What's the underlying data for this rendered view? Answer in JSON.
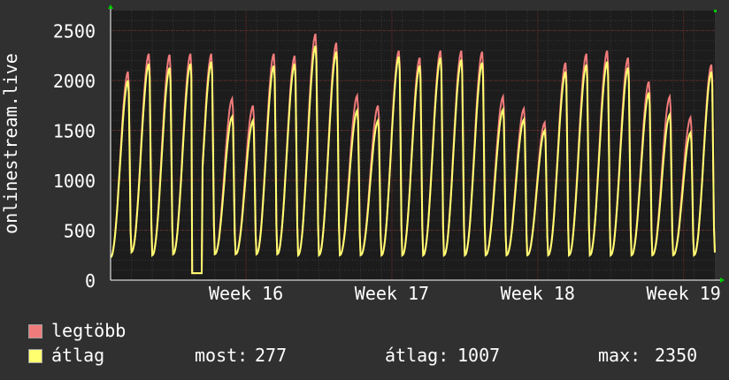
{
  "chart_data": {
    "type": "line",
    "ylabel": "onlinestream.live",
    "ylim": [
      0,
      2700
    ],
    "yticks": [
      0,
      500,
      1000,
      1500,
      2000,
      2500
    ],
    "x_tick_labels": [
      "Week 16",
      "Week 17",
      "Week 18",
      "Week 19"
    ],
    "x_days": [
      0,
      29
    ],
    "x_label_days": [
      6.5,
      13.5,
      20.5,
      27.5
    ],
    "grid": true,
    "legend_placement": "bottom",
    "series": [
      {
        "name": "legtöbb",
        "color": "#f07b7b"
      },
      {
        "name": "átlag",
        "color": "#ffff70"
      }
    ],
    "daily_max": [
      2090,
      2270,
      2260,
      2270,
      2270,
      1820,
      1750,
      2270,
      2250,
      2470,
      2380,
      1850,
      1750,
      2300,
      2230,
      2300,
      2300,
      2290,
      1840,
      1720,
      1580,
      2180,
      2270,
      2300,
      2230,
      1990,
      1840,
      1630,
      2160,
      2170
    ],
    "daily_avg": [
      2000,
      2170,
      2130,
      2170,
      2190,
      1640,
      1600,
      2150,
      2170,
      2350,
      2290,
      1700,
      1600,
      2240,
      2150,
      2230,
      2210,
      2180,
      1710,
      1610,
      1500,
      2090,
      2160,
      2190,
      2130,
      1880,
      1660,
      1480,
      2090,
      2080
    ],
    "daily_min": [
      230,
      280,
      250,
      260,
      260,
      260,
      260,
      260,
      260,
      250,
      250,
      250,
      250,
      250,
      250,
      250,
      250,
      250,
      250,
      250,
      250,
      250,
      250,
      250,
      250,
      250,
      250,
      250,
      250,
      277
    ],
    "gap": {
      "day_from": 3.9,
      "day_to": 4.4,
      "value": 70
    }
  },
  "legend": {
    "items": [
      {
        "label": "legtöbb",
        "color": "#f07b7b"
      },
      {
        "label": "átlag",
        "color": "#ffff70"
      }
    ],
    "stats": [
      {
        "label": "most:",
        "value": "277"
      },
      {
        "label": "átlag:",
        "value": "1007"
      },
      {
        "label": "max:",
        "value": "2350"
      }
    ]
  }
}
